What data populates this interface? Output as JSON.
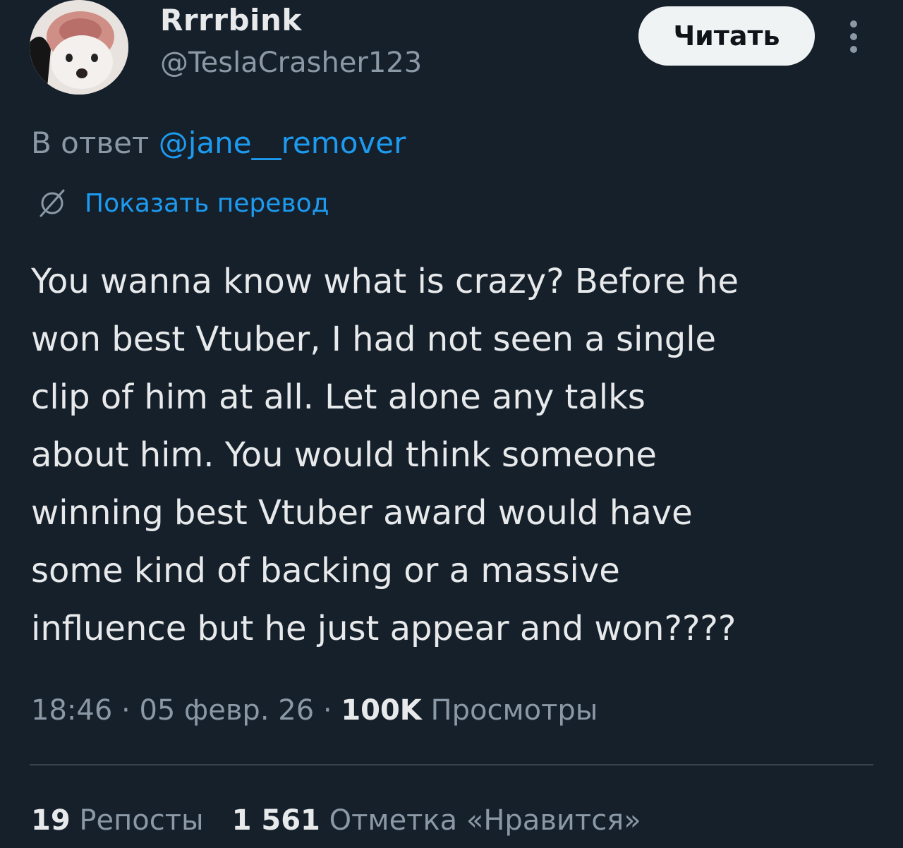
{
  "author": {
    "display_name": "Rrrrbink",
    "handle": "@TeslaCrasher123"
  },
  "header": {
    "follow_label": "Читать",
    "more_icon": "more-vertical-icon"
  },
  "reply": {
    "prefix": "В ответ ",
    "mention": "@jane__remover"
  },
  "translate": {
    "icon": "translate-globe-icon",
    "label": "Показать перевод"
  },
  "tweet": {
    "text": "You wanna know what is crazy? Before he\nwon best Vtuber, I had not seen a single\nclip of him at all. Let alone any talks\nabout him. You would think someone\nwinning best Vtuber award would have\nsome kind of backing or a massive\ninfluence but he just appear and won????"
  },
  "meta": {
    "time": "18:46",
    "separator": " · ",
    "date": "05 февр. 26",
    "views_count": "100K",
    "views_label": "Просмотры"
  },
  "stats": {
    "reposts_count": "19",
    "reposts_label": "Репосты",
    "likes_count": "1 561",
    "likes_label": "Отметка «Нравится»"
  },
  "colors": {
    "background": "#15202b",
    "text": "#e7e9ea",
    "muted": "#8b98a5",
    "accent": "#1d9bf0",
    "button_bg": "#eff3f4",
    "divider": "#38444d"
  }
}
